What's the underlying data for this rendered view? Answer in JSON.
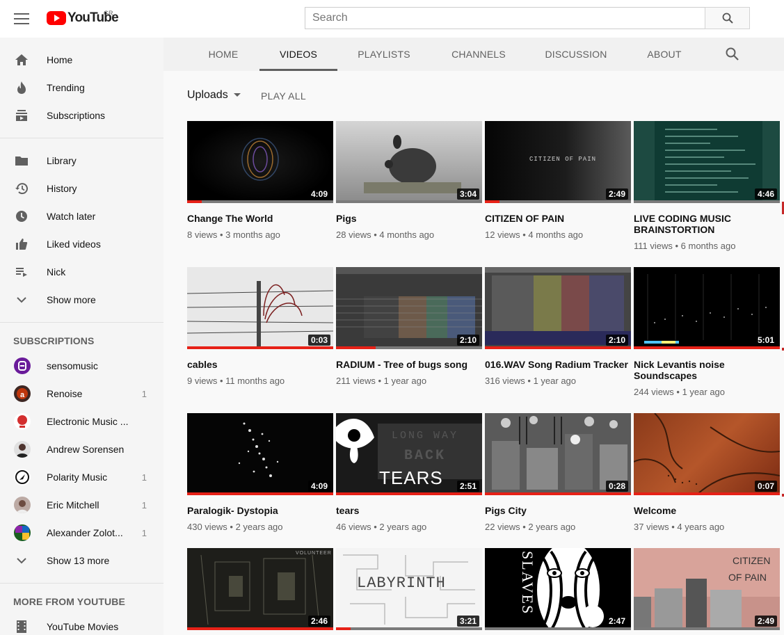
{
  "header": {
    "logo_text": "YouTube",
    "country": "GR",
    "search_placeholder": "Search"
  },
  "sidebar": {
    "main": [
      {
        "label": "Home",
        "icon": "home-icon"
      },
      {
        "label": "Trending",
        "icon": "flame-icon"
      },
      {
        "label": "Subscriptions",
        "icon": "subscriptions-icon"
      }
    ],
    "library": [
      {
        "label": "Library",
        "icon": "folder-icon"
      },
      {
        "label": "History",
        "icon": "history-icon"
      },
      {
        "label": "Watch later",
        "icon": "clock-icon"
      },
      {
        "label": "Liked videos",
        "icon": "thumbs-up-icon"
      },
      {
        "label": "Nick",
        "icon": "playlist-icon"
      },
      {
        "label": "Show more",
        "icon": "chevron-down-icon"
      }
    ],
    "subscriptions_heading": "SUBSCRIPTIONS",
    "subscriptions": [
      {
        "name": "sensomusic",
        "count": "",
        "color": "#7b1fa2"
      },
      {
        "name": "Renoise",
        "count": "1",
        "color": "#4e342e"
      },
      {
        "name": "Electronic Music ...",
        "count": "",
        "color": "#e53935"
      },
      {
        "name": "Andrew Sorensen",
        "count": "",
        "color": "#5d4037"
      },
      {
        "name": "Polarity Music",
        "count": "1",
        "color": "#212121"
      },
      {
        "name": "Eric Mitchell",
        "count": "1",
        "color": "#8d6e63"
      },
      {
        "name": "Alexander Zolot...",
        "count": "1",
        "color": "#2e7d32"
      }
    ],
    "show_more_subs": "Show 13 more",
    "more_heading": "MORE FROM YOUTUBE",
    "more": [
      {
        "label": "YouTube Movies",
        "icon": "film-icon"
      }
    ]
  },
  "tabs": [
    "HOME",
    "VIDEOS",
    "PLAYLISTS",
    "CHANNELS",
    "DISCUSSION",
    "ABOUT"
  ],
  "active_tab": "VIDEOS",
  "uploads_label": "Uploads",
  "play_all_label": "PLAY ALL",
  "videos": [
    {
      "title": "Change The World",
      "meta": "8 views • 3 months ago",
      "duration": "4:09",
      "progress": 0.1
    },
    {
      "title": "Pigs",
      "meta": "28 views • 4 months ago",
      "duration": "3:04",
      "progress": 0
    },
    {
      "title": "CITIZEN OF PAIN",
      "meta": "12 views • 4 months ago",
      "duration": "2:49",
      "progress": 0.1
    },
    {
      "title": "LIVE CODING MUSIC BRAINSTORTION",
      "meta": "111 views • 6 months ago",
      "duration": "4:46",
      "progress": 0
    },
    {
      "title": "cables",
      "meta": "9 views • 11 months ago",
      "duration": "0:03",
      "progress": 1
    },
    {
      "title": "RADIUM - Tree of bugs song",
      "meta": "211 views • 1 year ago",
      "duration": "2:10",
      "progress": 0.27
    },
    {
      "title": "016.WAV Song Radium Tracker",
      "meta": "316 views • 1 year ago",
      "duration": "2:10",
      "progress": 1
    },
    {
      "title": "Nick Levantis noise Soundscapes",
      "meta": "244 views • 1 year ago",
      "duration": "5:01",
      "progress": 1
    },
    {
      "title": "Paralogik- Dystopia",
      "meta": "430 views • 2 years ago",
      "duration": "4:09",
      "progress": 1
    },
    {
      "title": "tears",
      "meta": "46 views • 2 years ago",
      "duration": "2:51",
      "progress": 1
    },
    {
      "title": "Pigs City",
      "meta": "22 views • 2 years ago",
      "duration": "0:28",
      "progress": 1
    },
    {
      "title": "Welcome",
      "meta": "37 views • 4 years ago",
      "duration": "0:07",
      "progress": 1
    },
    {
      "title": "",
      "meta": "",
      "duration": "2:46",
      "progress": 1
    },
    {
      "title": "",
      "meta": "",
      "duration": "3:21",
      "progress": 0.1
    },
    {
      "title": "",
      "meta": "",
      "duration": "2:47",
      "progress": 0
    },
    {
      "title": "",
      "meta": "",
      "duration": "2:49",
      "progress": 0
    }
  ],
  "thumb_text": {
    "citizen": "CITIZEN OF PAIN",
    "tears_top": "LONG WAY",
    "tears_mid": "BACK",
    "tears_word": "TEARS",
    "labyrinth": "LABYRINTH",
    "slaves": "SLAVES",
    "volunteer": "VOLUNTEER",
    "citizen_script_1": "CITIZEN",
    "citizen_script_2": "OF PAIN"
  }
}
